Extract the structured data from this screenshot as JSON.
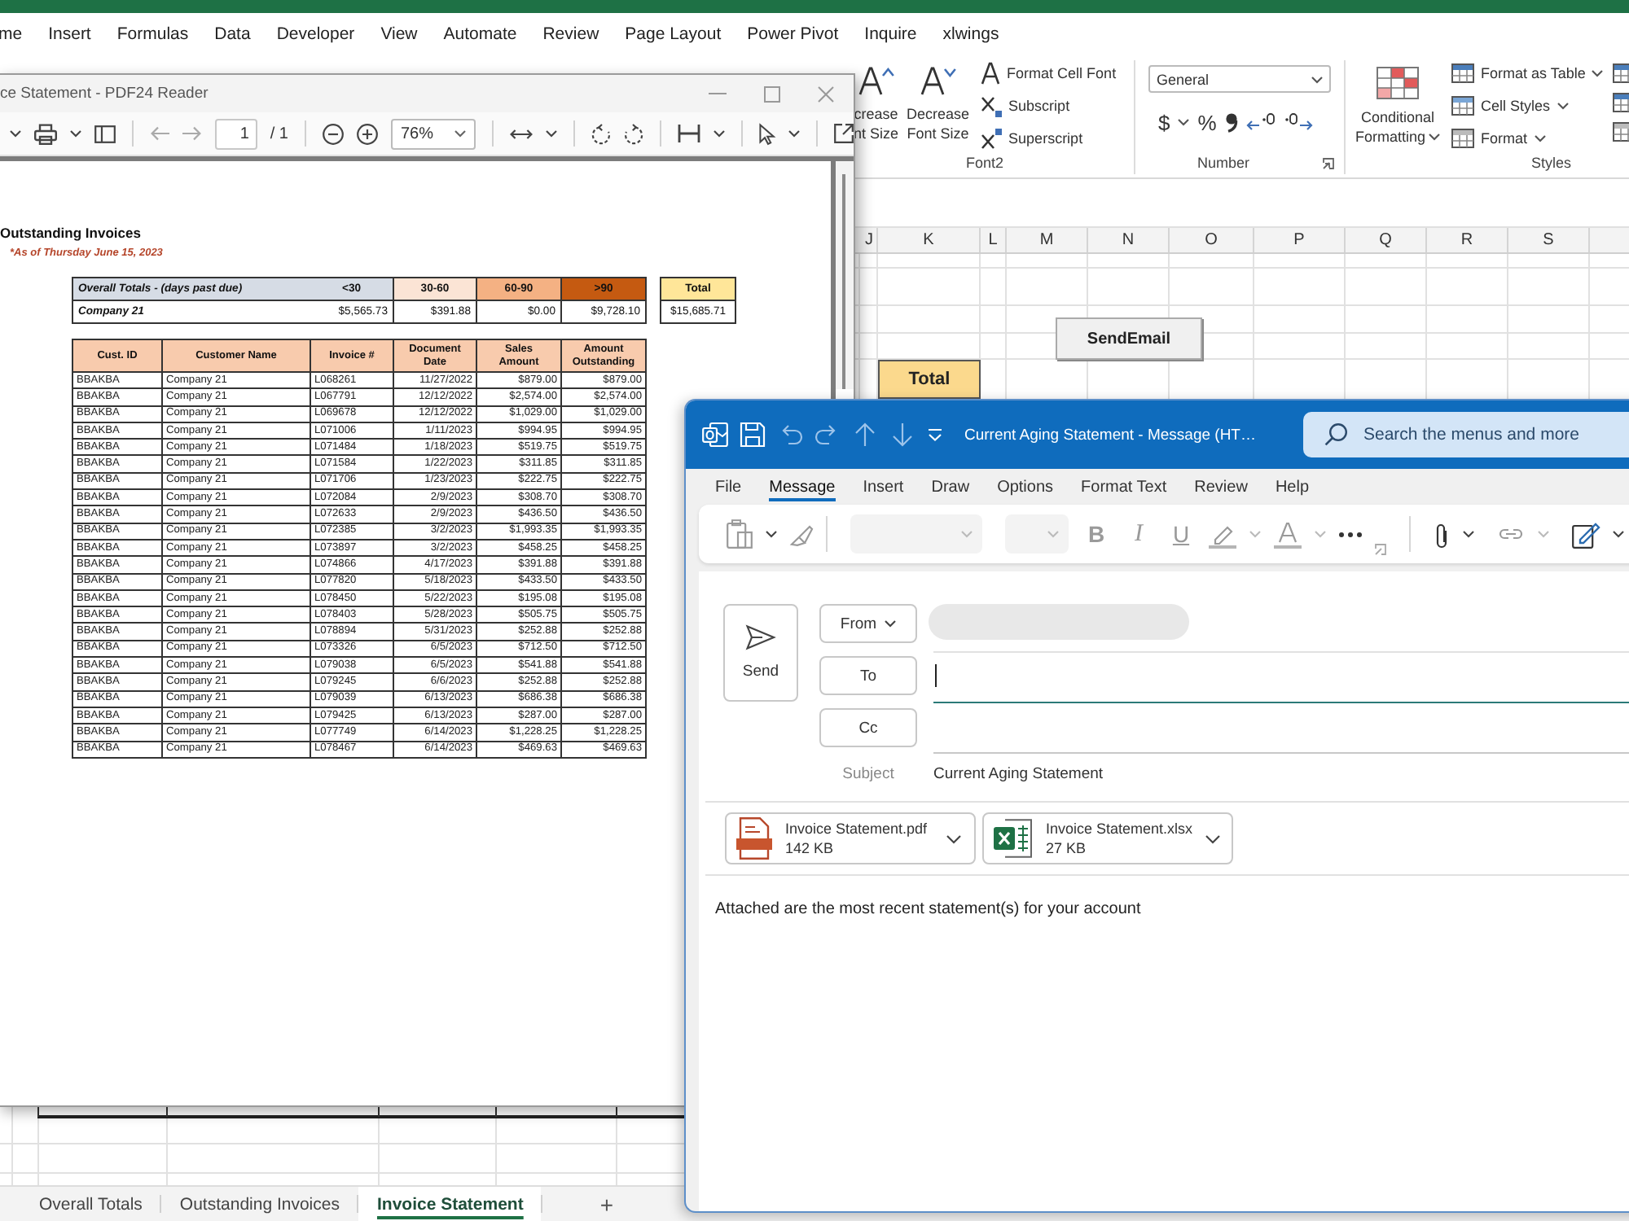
{
  "excel": {
    "ribbon_tabs": [
      "me",
      "Insert",
      "Formulas",
      "Data",
      "Developer",
      "View",
      "Automate",
      "Review",
      "Page Layout",
      "Power Pivot",
      "Inquire",
      "xlwings"
    ],
    "font_group": {
      "label": "Font2",
      "large_buttons": [
        {
          "kind": "increase",
          "label": "crease\nnt Size"
        },
        {
          "kind": "decrease",
          "label": "Decrease\nFont Size"
        }
      ],
      "small_buttons": [
        {
          "kind": "format",
          "label": "Format Cell Font"
        },
        {
          "kind": "subscript",
          "label": "Subscript"
        },
        {
          "kind": "superscript",
          "label": "Superscript"
        }
      ]
    },
    "number_group": {
      "label": "Number",
      "format": "General",
      "currency": "$",
      "percent": "%"
    },
    "styles_group": {
      "label": "Styles",
      "conditional": "Conditional\nFormatting",
      "buttons": [
        {
          "kind": "table",
          "label": "Format as Table"
        },
        {
          "kind": "cell",
          "label": "Cell Styles"
        },
        {
          "kind": "format",
          "label": "Format"
        }
      ]
    },
    "column_headers": [
      "J",
      "K",
      "L",
      "M",
      "N",
      "O",
      "P",
      "Q",
      "R",
      "S"
    ],
    "total_cell": "Total",
    "macro_button": "SendEmail",
    "sheet_tabs": [
      {
        "label": "Overall Totals",
        "selected": false
      },
      {
        "label": "Outstanding Invoices",
        "selected": false
      },
      {
        "label": "Invoice Statement",
        "selected": true
      }
    ],
    "add_sheet": "+"
  },
  "pdf_reader": {
    "title": "ce Statement - PDF24 Reader",
    "page": "1",
    "page_count": "/ 1",
    "zoom": "76%",
    "document": {
      "heading": "Outstanding Invoices",
      "as_of": "*As of Thursday June 15, 2023",
      "aging": {
        "columns": [
          {
            "label": "Overall Totals - (days past due)",
            "color": "#d6dce5"
          },
          {
            "label": "<30",
            "color": "#d6dce5"
          },
          {
            "label": "30-60",
            "color": "#fbe4d5"
          },
          {
            "label": "60-90",
            "color": "#f4b183"
          },
          {
            "label": ">90",
            "color": "#c55a11"
          }
        ],
        "values": [
          "Company 21",
          "$5,565.73",
          "$391.88",
          "$0.00",
          "$9,728.10"
        ]
      },
      "total": {
        "label": "Total",
        "value": "$15,685.71"
      },
      "invoices": {
        "columns": [
          "Cust. ID",
          "Customer Name",
          "Invoice #",
          "Document\nDate",
          "Sales\nAmount",
          "Amount\nOutstanding"
        ],
        "rows": [
          [
            "BBAKBA",
            "Company 21",
            "L068261",
            "11/27/2022",
            "$879.00",
            "$879.00"
          ],
          [
            "BBAKBA",
            "Company 21",
            "L067791",
            "12/12/2022",
            "$2,574.00",
            "$2,574.00"
          ],
          [
            "BBAKBA",
            "Company 21",
            "L069678",
            "12/12/2022",
            "$1,029.00",
            "$1,029.00"
          ],
          [
            "BBAKBA",
            "Company 21",
            "L071006",
            "1/11/2023",
            "$994.95",
            "$994.95"
          ],
          [
            "BBAKBA",
            "Company 21",
            "L071484",
            "1/18/2023",
            "$519.75",
            "$519.75"
          ],
          [
            "BBAKBA",
            "Company 21",
            "L071584",
            "1/22/2023",
            "$311.85",
            "$311.85"
          ],
          [
            "BBAKBA",
            "Company 21",
            "L071706",
            "1/23/2023",
            "$222.75",
            "$222.75"
          ],
          [
            "BBAKBA",
            "Company 21",
            "L072084",
            "2/9/2023",
            "$308.70",
            "$308.70"
          ],
          [
            "BBAKBA",
            "Company 21",
            "L072633",
            "2/9/2023",
            "$436.50",
            "$436.50"
          ],
          [
            "BBAKBA",
            "Company 21",
            "L072385",
            "3/2/2023",
            "$1,993.35",
            "$1,993.35"
          ],
          [
            "BBAKBA",
            "Company 21",
            "L073897",
            "3/2/2023",
            "$458.25",
            "$458.25"
          ],
          [
            "BBAKBA",
            "Company 21",
            "L074866",
            "4/17/2023",
            "$391.88",
            "$391.88"
          ],
          [
            "BBAKBA",
            "Company 21",
            "L077820",
            "5/18/2023",
            "$433.50",
            "$433.50"
          ],
          [
            "BBAKBA",
            "Company 21",
            "L078450",
            "5/22/2023",
            "$195.08",
            "$195.08"
          ],
          [
            "BBAKBA",
            "Company 21",
            "L078403",
            "5/28/2023",
            "$505.75",
            "$505.75"
          ],
          [
            "BBAKBA",
            "Company 21",
            "L078894",
            "5/31/2023",
            "$252.88",
            "$252.88"
          ],
          [
            "BBAKBA",
            "Company 21",
            "L073326",
            "6/5/2023",
            "$712.50",
            "$712.50"
          ],
          [
            "BBAKBA",
            "Company 21",
            "L079038",
            "6/5/2023",
            "$541.88",
            "$541.88"
          ],
          [
            "BBAKBA",
            "Company 21",
            "L079245",
            "6/6/2023",
            "$252.88",
            "$252.88"
          ],
          [
            "BBAKBA",
            "Company 21",
            "L079039",
            "6/13/2023",
            "$686.38",
            "$686.38"
          ],
          [
            "BBAKBA",
            "Company 21",
            "L079425",
            "6/13/2023",
            "$287.00",
            "$287.00"
          ],
          [
            "BBAKBA",
            "Company 21",
            "L077749",
            "6/14/2023",
            "$1,228.25",
            "$1,228.25"
          ],
          [
            "BBAKBA",
            "Company 21",
            "L078467",
            "6/14/2023",
            "$469.63",
            "$469.63"
          ]
        ]
      }
    }
  },
  "outlook": {
    "title": "Current Aging Statement - Message (HT…",
    "search": {
      "placeholder": "Search the menus and more"
    },
    "tabs": [
      {
        "label": "File",
        "selected": false
      },
      {
        "label": "Message",
        "selected": true
      },
      {
        "label": "Insert",
        "selected": false
      },
      {
        "label": "Draw",
        "selected": false
      },
      {
        "label": "Options",
        "selected": false
      },
      {
        "label": "Format Text",
        "selected": false
      },
      {
        "label": "Review",
        "selected": false
      },
      {
        "label": "Help",
        "selected": false
      }
    ],
    "format_buttons": [
      {
        "kind": "bold",
        "label": "B",
        "disabled": true
      },
      {
        "kind": "italic",
        "label": "I",
        "disabled": true
      },
      {
        "kind": "underline",
        "label": "U",
        "disabled": true
      }
    ],
    "send": "Send",
    "from": "From",
    "recipients": [
      {
        "label": "To",
        "focused": true
      },
      {
        "label": "Cc",
        "focused": false
      }
    ],
    "subject": {
      "label": "Subject",
      "value": "Current Aging Statement"
    },
    "attachments": [
      {
        "kind": "pdf",
        "name": "Invoice Statement.pdf",
        "size": "142 KB"
      },
      {
        "kind": "xlsx",
        "name": "Invoice Statement.xlsx",
        "size": "27 KB"
      }
    ],
    "body": "Attached are the most recent statement(s) for your account"
  }
}
